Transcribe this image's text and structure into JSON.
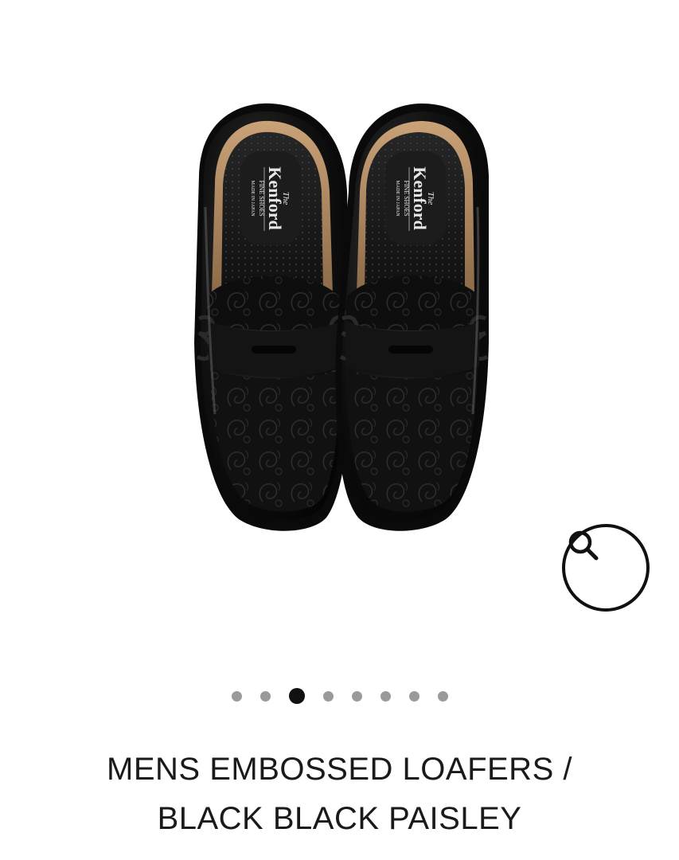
{
  "product": {
    "title_line1": "MENS EMBOSSED LOAFERS /",
    "title_line2": "BLACK BLACK PAISLEY",
    "insole_brand": {
      "the": "The",
      "name": "Kenford",
      "tagline": "FINE SHOES",
      "origin": "MADE IN JAPAN"
    }
  },
  "gallery": {
    "total_images": 8,
    "active_index": 2,
    "zoom_icon": "search-icon"
  },
  "colors": {
    "accent": "#111111",
    "dot_inactive": "#9a9a9a",
    "background": "#ffffff"
  }
}
